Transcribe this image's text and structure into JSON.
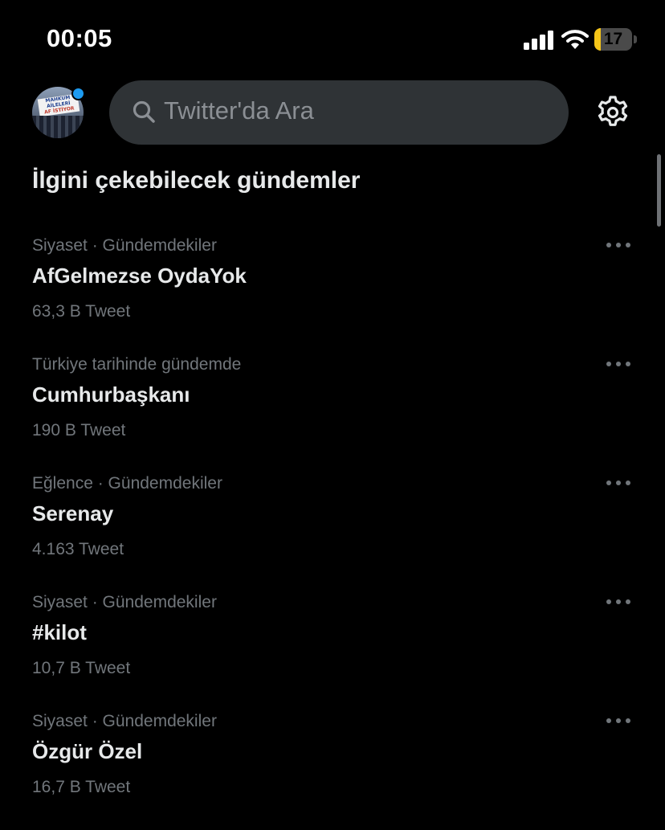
{
  "status_bar": {
    "time": "00:05",
    "battery_level": "17",
    "battery_fraction": 0.17,
    "battery_color": "#f5c518",
    "icons": [
      "signal-icon",
      "wifi-icon",
      "battery-icon"
    ]
  },
  "header": {
    "avatar_text": [
      "MAHKUM",
      "AİLELERİ",
      "AF İSTİYOR"
    ],
    "search_placeholder": "Twitter'da Ara",
    "icons": [
      "search-icon",
      "settings-gear-icon"
    ]
  },
  "content": {
    "section_title": "İlgini çekebilecek gündemler",
    "trends": [
      {
        "context": "Siyaset · Gündemdekiler",
        "name": "AfGelmezse OydaYok",
        "count": "63,3 B Tweet"
      },
      {
        "context": "Türkiye tarihinde gündemde",
        "name": "Cumhurbaşkanı",
        "count": "190 B Tweet"
      },
      {
        "context": "Eğlence · Gündemdekiler",
        "name": "Serenay",
        "count": "4.163 Tweet"
      },
      {
        "context": "Siyaset · Gündemdekiler",
        "name": "#kilot",
        "count": "10,7 B Tweet"
      },
      {
        "context": "Siyaset · Gündemdekiler",
        "name": "Özgür Özel",
        "count": "16,7 B Tweet"
      }
    ]
  },
  "colors": {
    "background": "#000000",
    "search_background": "#2f3336",
    "primary_text": "#e7e9ea",
    "secondary_text": "#71767b",
    "accent": "#1d9bf0"
  }
}
